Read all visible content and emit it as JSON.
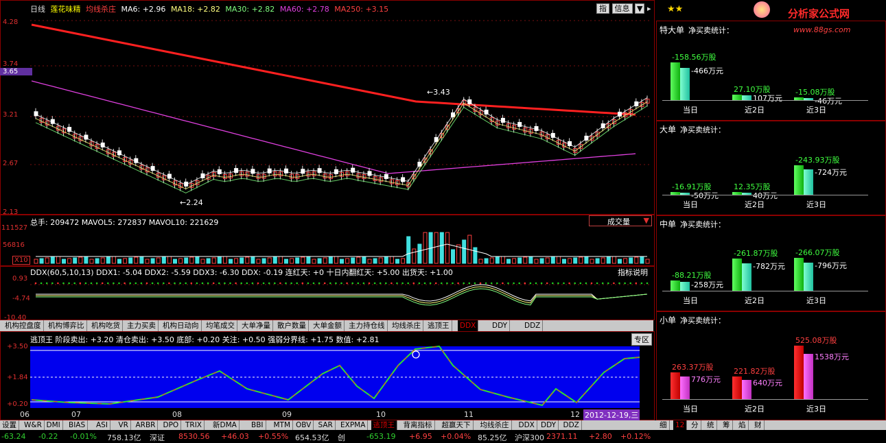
{
  "kline": {
    "period": "日线",
    "stock_name": "莲花味精",
    "indicator_name": "均线杀庄",
    "ma": [
      {
        "label": "MA6: +2.96",
        "color": "#ffffff"
      },
      {
        "label": "MA18: +2.82",
        "color": "#ffffff"
      },
      {
        "label": "MA30: +2.82",
        "color": "#ffffff"
      },
      {
        "label": "MA60: +2.78",
        "color": "#e040e0"
      },
      {
        "label": "MA250: +3.15",
        "color": "#ff4040"
      }
    ],
    "buttons": [
      "指",
      "信息"
    ],
    "y_ticks": [
      "4.28",
      "3.74",
      "3.65",
      "3.21",
      "2.67",
      "2.13"
    ],
    "high_label": "3.43",
    "low_label": "2.24"
  },
  "volume": {
    "header": "总手: 209472  MAVOL5: 272837  MAVOL10: 221629",
    "dropdown": "成交量",
    "y_ticks": [
      "111527",
      "56816",
      "X10"
    ]
  },
  "ddx": {
    "header": "DDX(60,5,10,13) DDX1: -5.04  DDX2: -5.59  DDX3: -6.30  DDX: -0.19  连红天: +0  十日内翻红天: +5.00  出货天: +1.00",
    "button": "指标说明",
    "y_ticks": [
      "0.93",
      "-4.74",
      "-10.40"
    ]
  },
  "tabs": [
    "机构控盘度",
    "机构博弈比",
    "机构吃货",
    "主力买卖",
    "机构日动向",
    "均笔成交",
    "大单净量",
    "散户数量",
    "大单金额",
    "主力持仓线",
    "均线杀庄",
    "逃顶王",
    "DDX",
    "DDY",
    "DDZ"
  ],
  "active_tab": "DDX",
  "taoding": {
    "header": "逃顶王 阶段卖出: +3.20  清仓卖出: +3.50  底部: +0.20  关注: +0.50  强弱分界线: +1.75  数值: +2.81",
    "button": "专区",
    "y_ticks": [
      "+3.50",
      "+1.84",
      "+0.20"
    ],
    "x_labels": [
      "06",
      "07",
      "08",
      "09",
      "10",
      "11",
      "12"
    ],
    "date_label": "2012-12-19,三"
  },
  "bottom_tabs": [
    "设置",
    "W&R",
    "DMI",
    "BIAS",
    "ASI",
    "VR",
    "ARBR",
    "DPO",
    "TRIX",
    "新DMA",
    "BBI",
    "MTM",
    "OBV",
    "SAR",
    "EXPMA",
    "逃顶王",
    "背离指标",
    "超赢天下",
    "均线杀庄",
    "DDX",
    "DDY",
    "DDZ"
  ],
  "active_bottom_tab": "逃顶王",
  "right_tabs": [
    "细",
    "12",
    "分",
    "统",
    "筹",
    "焰",
    "财"
  ],
  "ticker": [
    "-63.24",
    "-0.22",
    "-0.01%",
    "758.13亿",
    "深证",
    "8530.56",
    "+46.03",
    "+0.55%",
    "654.53亿",
    "创",
    "-653.19",
    "+6.95",
    "+0.04%",
    "85.25亿",
    "沪深300",
    "2371.11",
    "+2.80",
    "+0.12%"
  ],
  "logo": {
    "title": "分析家公式网",
    "url": "www.88gs.com",
    "stars": "★★"
  },
  "panels": [
    {
      "title": "特大单",
      "subtitle": "净买卖统计：",
      "bar_color": "green",
      "labels": [
        [
          "-158.56万股",
          "-466万元"
        ],
        [
          "27.10万股",
          "107万元"
        ],
        [
          "-15.08万股",
          "-46万元"
        ]
      ],
      "x": [
        "当日",
        "近2日",
        "近3日"
      ],
      "heights": [
        0.85,
        0.12,
        0.05
      ]
    },
    {
      "title": "大单",
      "subtitle": "净买卖统计：",
      "bar_color": "green",
      "labels": [
        [
          "-16.91万股",
          "-50万元"
        ],
        [
          "12.35万股",
          "40万元"
        ],
        [
          "-243.93万股",
          "-724万元"
        ]
      ],
      "x": [
        "当日",
        "近2日",
        "近3日"
      ],
      "heights": [
        0.05,
        0.05,
        0.75
      ]
    },
    {
      "title": "中单",
      "subtitle": "净买卖统计：",
      "bar_color": "green",
      "labels": [
        [
          "-88.21万股",
          "-258万元"
        ],
        [
          "-261.87万股",
          "-782万元"
        ],
        [
          "-266.07万股",
          "-796万元"
        ]
      ],
      "x": [
        "当日",
        "近2日",
        "近3日"
      ],
      "heights": [
        0.25,
        0.78,
        0.8
      ]
    },
    {
      "title": "小单",
      "subtitle": "净买卖统计：",
      "bar_color": "red",
      "labels": [
        [
          "263.37万股",
          "776万元"
        ],
        [
          "221.82万股",
          "640万元"
        ],
        [
          "525.08万股",
          "1538万元"
        ]
      ],
      "x": [
        "当日",
        "近2日",
        "近3日"
      ],
      "heights": [
        0.5,
        0.42,
        1.0
      ]
    }
  ]
}
